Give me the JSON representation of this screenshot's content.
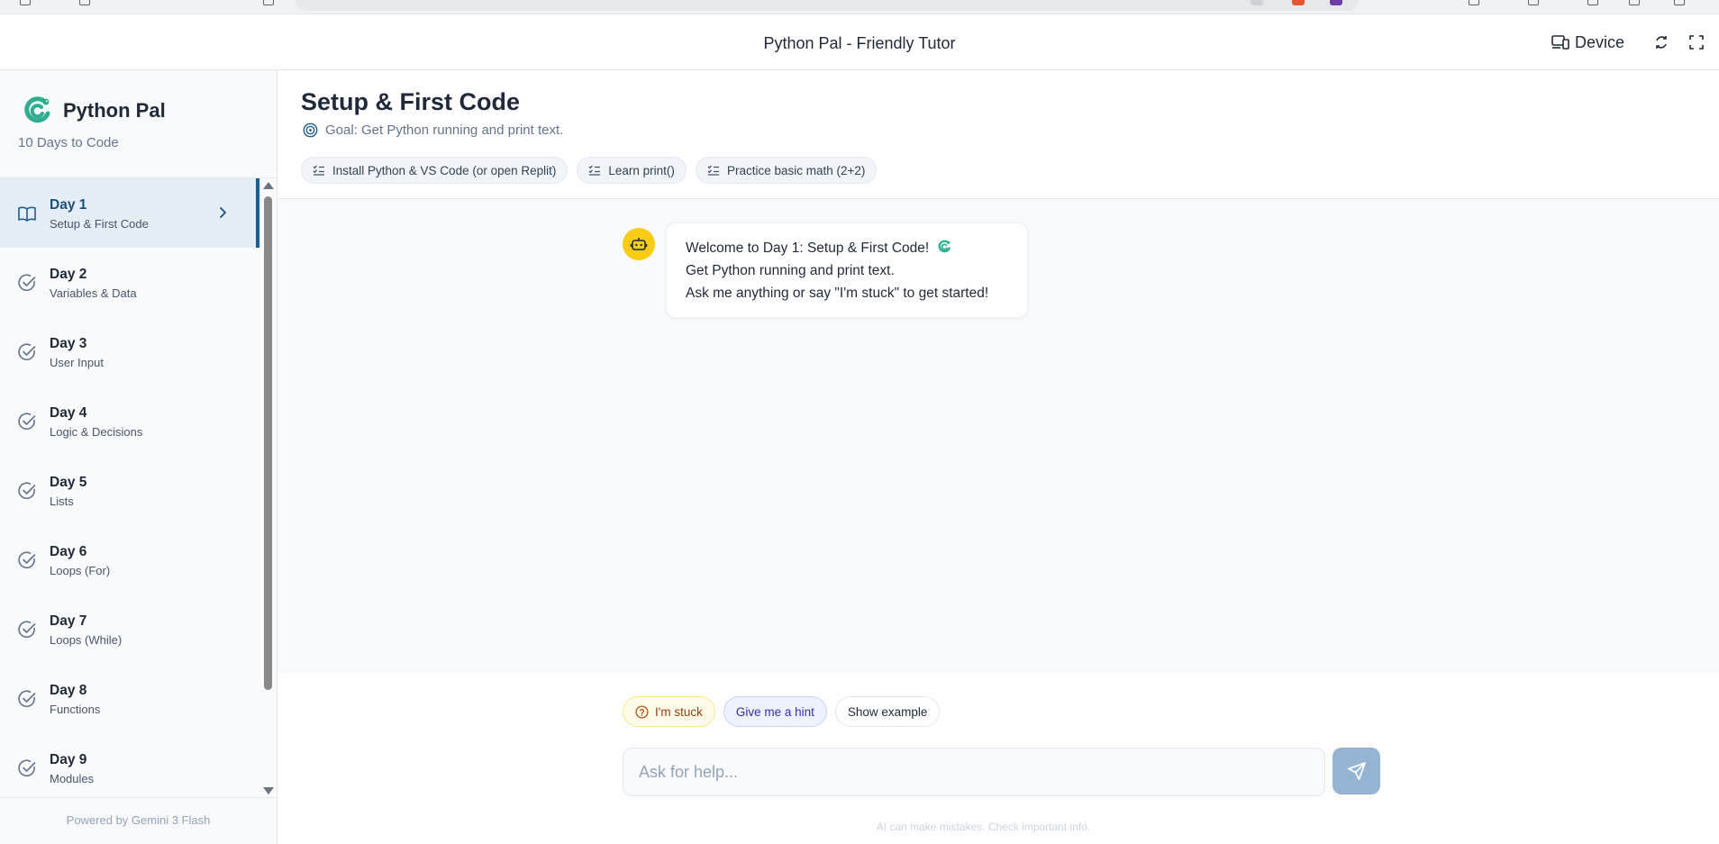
{
  "app": {
    "title": "Python Pal - Friendly Tutor",
    "device_label": "Device"
  },
  "sidebar": {
    "brand_name": "Python Pal",
    "brand_sub": "10 Days to Code",
    "footer": "Powered by Gemini 3 Flash",
    "days": [
      {
        "title": "Day 1",
        "subtitle": "Setup & First Code",
        "status": "active",
        "icon": "book-open-icon"
      },
      {
        "title": "Day 2",
        "subtitle": "Variables & Data",
        "status": "pending",
        "icon": "check-circle-icon"
      },
      {
        "title": "Day 3",
        "subtitle": "User Input",
        "status": "pending",
        "icon": "check-circle-icon"
      },
      {
        "title": "Day 4",
        "subtitle": "Logic & Decisions",
        "status": "pending",
        "icon": "check-circle-icon"
      },
      {
        "title": "Day 5",
        "subtitle": "Lists",
        "status": "pending",
        "icon": "check-circle-icon"
      },
      {
        "title": "Day 6",
        "subtitle": "Loops (For)",
        "status": "pending",
        "icon": "check-circle-icon"
      },
      {
        "title": "Day 7",
        "subtitle": "Loops (While)",
        "status": "pending",
        "icon": "check-circle-icon"
      },
      {
        "title": "Day 8",
        "subtitle": "Functions",
        "status": "pending",
        "icon": "check-circle-icon"
      },
      {
        "title": "Day 9",
        "subtitle": "Modules",
        "status": "pending",
        "icon": "check-circle-icon"
      }
    ]
  },
  "lesson": {
    "title": "Setup & First Code",
    "goal": "Goal: Get Python running and print text.",
    "tasks": [
      "Install Python & VS Code (or open Replit)",
      "Learn print()",
      "Practice basic math (2+2)"
    ]
  },
  "chat": {
    "messages": [
      {
        "role": "bot",
        "lines": [
          "Welcome to Day 1: Setup & First Code!",
          "Get Python running and print text.",
          "Ask me anything or say \"I'm stuck\" to get started!"
        ]
      }
    ]
  },
  "composer": {
    "quick_actions": {
      "stuck": "I'm stuck",
      "hint": "Give me a hint",
      "example": "Show example"
    },
    "placeholder": "Ask for help...",
    "value": "",
    "disclaimer": "AI can make mistakes. Check important info."
  },
  "colors": {
    "accent": "#1d5d90",
    "brand_green": "#2fae8f",
    "bot_avatar": "#facc15",
    "send_button": "#94b4d2"
  }
}
